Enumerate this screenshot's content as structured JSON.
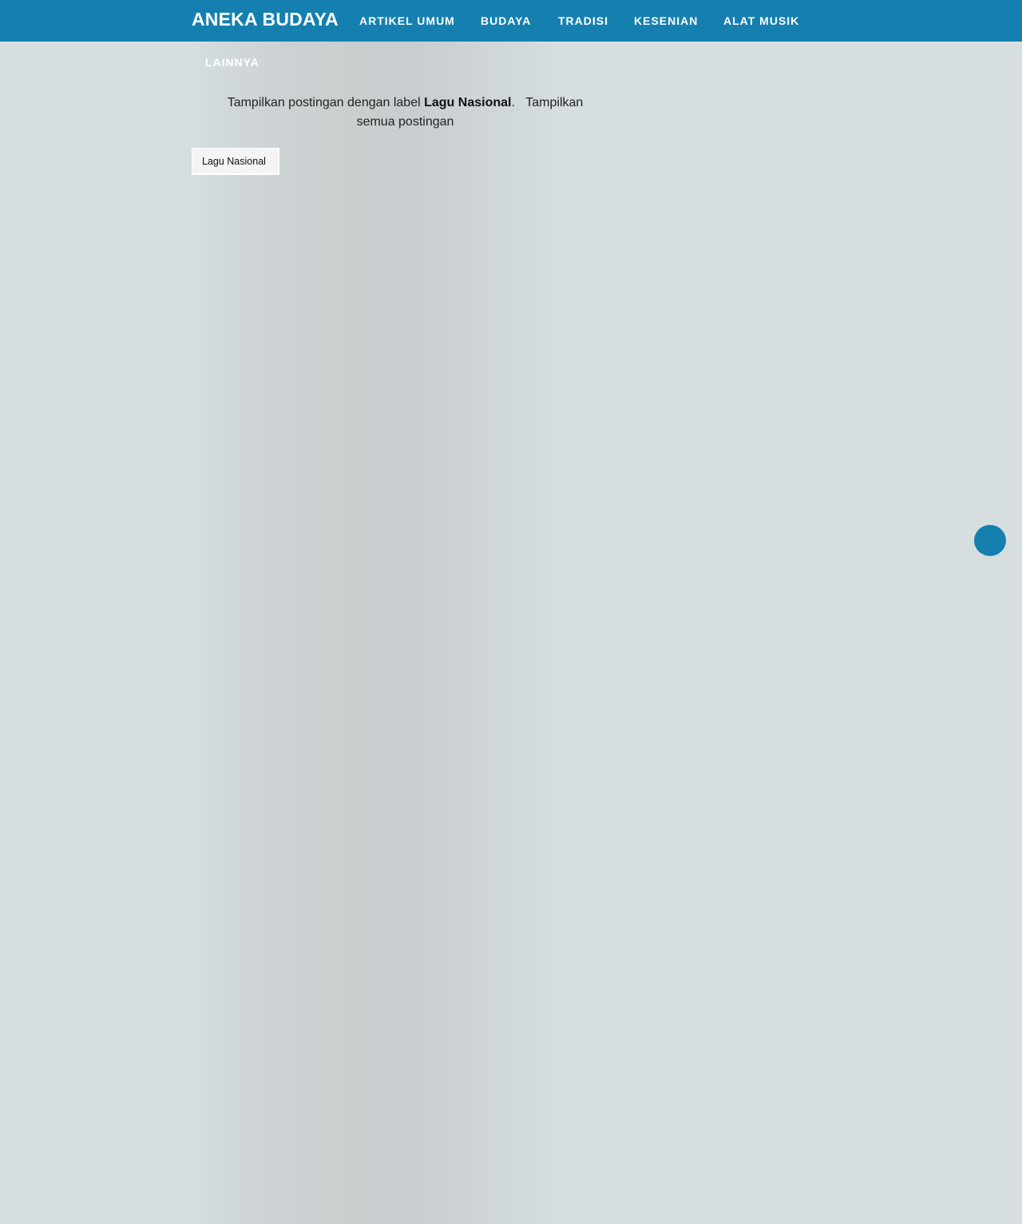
{
  "header": {
    "brand": "ANEKA BUDAYA",
    "nav": [
      {
        "label": "ARTIKEL UMUM"
      },
      {
        "label": "BUDAYA"
      },
      {
        "label": "TRADISI"
      },
      {
        "label": "KESENIAN"
      },
      {
        "label": "ALAT MUSIK"
      },
      {
        "label": "LAINNYA"
      }
    ]
  },
  "status": {
    "prefix": "Tampilkan postingan dengan label ",
    "label": "Lagu Nasional",
    "suffix": ".",
    "show_all": "Tampilkan semua postingan"
  },
  "labels": {
    "chip": "Lagu Nasional"
  },
  "colors": {
    "brand_blue": "#1580b0",
    "background": "#d6dee0"
  },
  "icons": {
    "floating_button": "back-to-top-icon"
  }
}
